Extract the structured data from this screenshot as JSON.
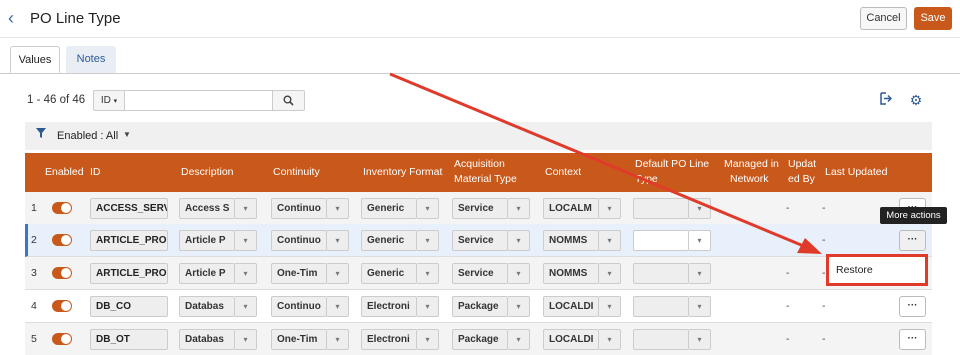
{
  "header": {
    "title": "PO Line Type",
    "cancel_label": "Cancel",
    "save_label": "Save"
  },
  "tabs": [
    {
      "label": "Values",
      "active": true
    },
    {
      "label": "Notes",
      "active": false
    }
  ],
  "toolbar": {
    "count_text": "1 - 46 of 46",
    "search_field": "ID",
    "search_value": ""
  },
  "filter": {
    "label": "Enabled : All"
  },
  "columns": [
    "Enabled",
    "ID",
    "Description",
    "Continuity",
    "Inventory Format",
    "Acquisition Material Type",
    "Context",
    "Default PO Line Type",
    "Managed in Network",
    "Updated By",
    "Last Updated"
  ],
  "header_labels": {
    "enabled": "Enabled",
    "id": "ID",
    "description": "Description",
    "continuity": "Continuity",
    "inventory_format": "Inventory Format",
    "acq_line1": "Acquisition",
    "acq_line2": "Material Type",
    "context": "Context",
    "default_line1": "Default PO Line",
    "default_line2": "Type",
    "managed_line1": "Managed in",
    "managed_line2": "Network",
    "updated_line1": "Updat",
    "updated_line2": "ed By",
    "last_updated": "Last Updated"
  },
  "rows": [
    {
      "num": "1",
      "enabled": true,
      "id": "ACCESS_SERV",
      "description": "Access S",
      "continuity": "Continuo",
      "inventory_format": "Generic",
      "material_type": "Service",
      "context": "LOCALM",
      "updated_by": "-",
      "last_updated": "-"
    },
    {
      "num": "2",
      "enabled": true,
      "id": "ARTICLE_PRO",
      "description": "Article P",
      "continuity": "Continuo",
      "inventory_format": "Generic",
      "material_type": "Service",
      "context": "NOMMS",
      "updated_by": "",
      "last_updated": "-"
    },
    {
      "num": "3",
      "enabled": true,
      "id": "ARTICLE_PRO",
      "description": "Article P",
      "continuity": "One-Tim",
      "inventory_format": "Generic",
      "material_type": "Service",
      "context": "NOMMS",
      "updated_by": "-",
      "last_updated": "-"
    },
    {
      "num": "4",
      "enabled": true,
      "id": "DB_CO",
      "description": "Databas",
      "continuity": "Continuo",
      "inventory_format": "Electroni",
      "material_type": "Package",
      "context": "LOCALDI",
      "updated_by": "-",
      "last_updated": "-"
    },
    {
      "num": "5",
      "enabled": true,
      "id": "DB_OT",
      "description": "Databas",
      "continuity": "One-Tim",
      "inventory_format": "Electroni",
      "material_type": "Package",
      "context": "LOCALDI",
      "updated_by": "-",
      "last_updated": "-"
    }
  ],
  "tooltip": {
    "text": "More actions"
  },
  "menu": {
    "items": [
      "Restore"
    ]
  },
  "more_label": "···",
  "dropdown_arrow": "▾",
  "colors": {
    "accent": "#c9591a",
    "link": "#2c5b93",
    "annotation": "#e03b2a",
    "selected_row": "#e8f0fb"
  },
  "icons": [
    "back-chevron-icon",
    "search-icon",
    "export-icon",
    "gear-icon",
    "filter-icon",
    "chevron-down-icon",
    "more-actions-icon"
  ]
}
